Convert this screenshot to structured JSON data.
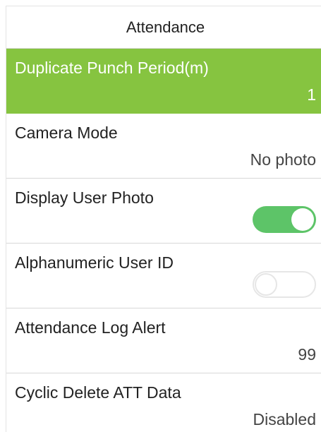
{
  "header": {
    "title": "Attendance"
  },
  "colors": {
    "selected_bg": "#86c440",
    "toggle_on": "#5dc468",
    "toggle_off_border": "#e6e6e6"
  },
  "items": [
    {
      "label": "Duplicate Punch Period(m)",
      "value": "1",
      "selected": true
    },
    {
      "label": "Camera Mode",
      "value": "No photo"
    },
    {
      "label": "Display User Photo",
      "toggle": "on"
    },
    {
      "label": "Alphanumeric User ID",
      "toggle": "off"
    },
    {
      "label": "Attendance Log Alert",
      "value": "99"
    },
    {
      "label": "Cyclic Delete ATT Data",
      "value": "Disabled"
    }
  ]
}
